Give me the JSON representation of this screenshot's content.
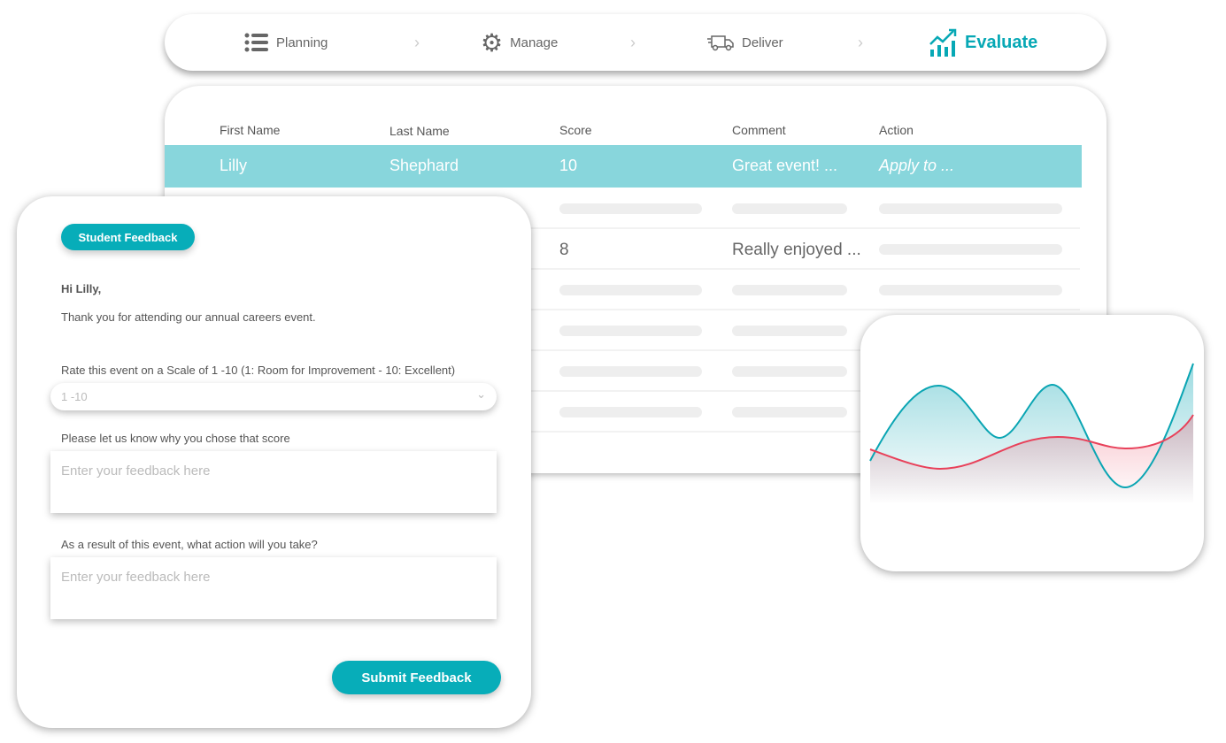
{
  "nav": {
    "steps": [
      {
        "label": "Planning",
        "icon": "list-icon"
      },
      {
        "label": "Manage",
        "icon": "gear-icon"
      },
      {
        "label": "Deliver",
        "icon": "truck-icon"
      },
      {
        "label": "Evaluate",
        "icon": "chart-growth-icon",
        "active": true
      }
    ]
  },
  "table": {
    "columns": [
      "First Name",
      "Last Name",
      "Score",
      "Comment",
      "Action"
    ],
    "selected_row": {
      "first": "Lilly",
      "last": "Shephard",
      "score": "10",
      "comment": "Great event! ...",
      "action": "Apply to ..."
    },
    "row2": {
      "score": "8",
      "comment": "Really enjoyed ..."
    }
  },
  "form": {
    "badge": "Student Feedback",
    "greeting": "Hi Lilly,",
    "intro": "Thank you for attending our annual careers event.",
    "rate_label": "Rate this event on a Scale of 1 -10 (1: Room for Improvement - 10: Excellent)",
    "rate_placeholder": "1 -10",
    "why_label": "Please let us know why you chose that score",
    "why_placeholder": "Enter your feedback here",
    "action_label": "As a result of this event, what action will you take?",
    "action_placeholder": "Enter your feedback here",
    "submit": "Submit Feedback"
  },
  "colors": {
    "accent": "#07adb9",
    "highlight": "#88d6dc",
    "series_teal": "#0aa5b3",
    "series_red": "#e8415a"
  }
}
